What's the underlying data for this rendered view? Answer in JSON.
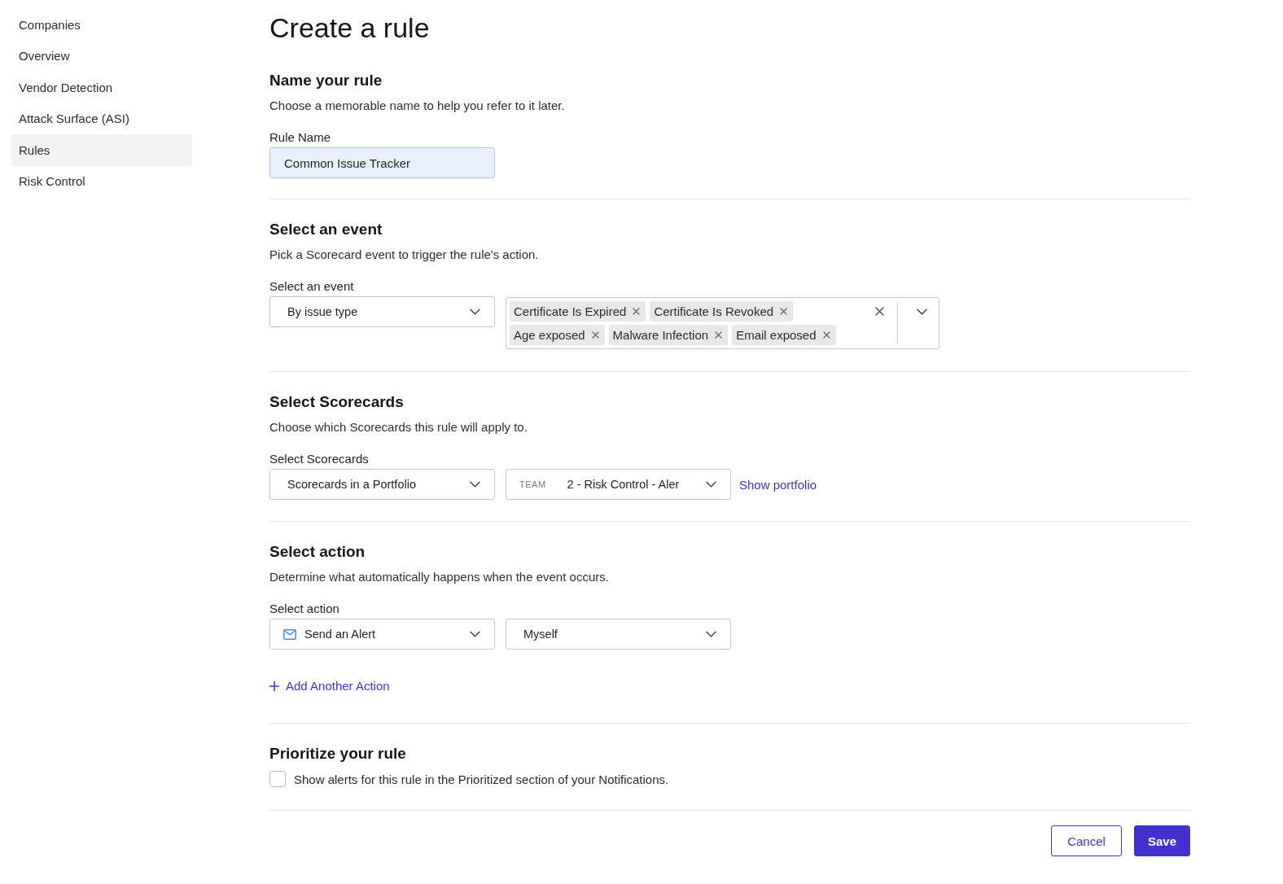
{
  "sidebar": {
    "items": [
      {
        "label": "Companies",
        "selected": false
      },
      {
        "label": "Overview",
        "selected": false
      },
      {
        "label": "Vendor Detection",
        "selected": false
      },
      {
        "label": "Attack Surface (ASI)",
        "selected": false
      },
      {
        "label": "Rules",
        "selected": true
      },
      {
        "label": "Risk Control",
        "selected": false
      }
    ]
  },
  "page": {
    "title": "Create a rule"
  },
  "name_section": {
    "heading": "Name your rule",
    "description": "Choose a memorable name to help you refer to it later.",
    "field": {
      "label": "Rule Name",
      "value": "Common Issue Tracker"
    }
  },
  "event_section": {
    "heading": "Select an event",
    "description": "Pick a Scorecard event to trigger the rule's action.",
    "label": "Select an event",
    "event_select": {
      "value": "By issue type"
    },
    "issue_types": [
      "Certificate Is Expired",
      "Certificate Is Revoked",
      "Age exposed",
      "Malware Infection",
      "Email exposed"
    ]
  },
  "scorecards_section": {
    "heading": "Select Scorecards",
    "description": "Choose which Scorecards this rule will apply to.",
    "label": "Select Scorecards",
    "scope_select": {
      "value": "Scorecards in a Portfolio"
    },
    "portfolio_select": {
      "prefix": "TEAM",
      "value": "2 - Risk Control - Aler"
    },
    "link": "Show portfolio"
  },
  "action_section": {
    "heading": "Select action",
    "description": "Determine what automatically happens when the event occurs.",
    "label": "Select action",
    "action_select": {
      "value": "Send an Alert"
    },
    "recipient_select": {
      "value": "Myself"
    },
    "add_button": "Add Another Action"
  },
  "priority_section": {
    "heading": "Prioritize your rule",
    "checkbox": {
      "label": "Show alerts for this rule in the Prioritized section of your Notifications.",
      "checked": false
    }
  },
  "footer": {
    "buttons": [
      {
        "label": "Cancel",
        "kind": "secondary"
      },
      {
        "label": "Save",
        "kind": "primary"
      }
    ]
  }
}
